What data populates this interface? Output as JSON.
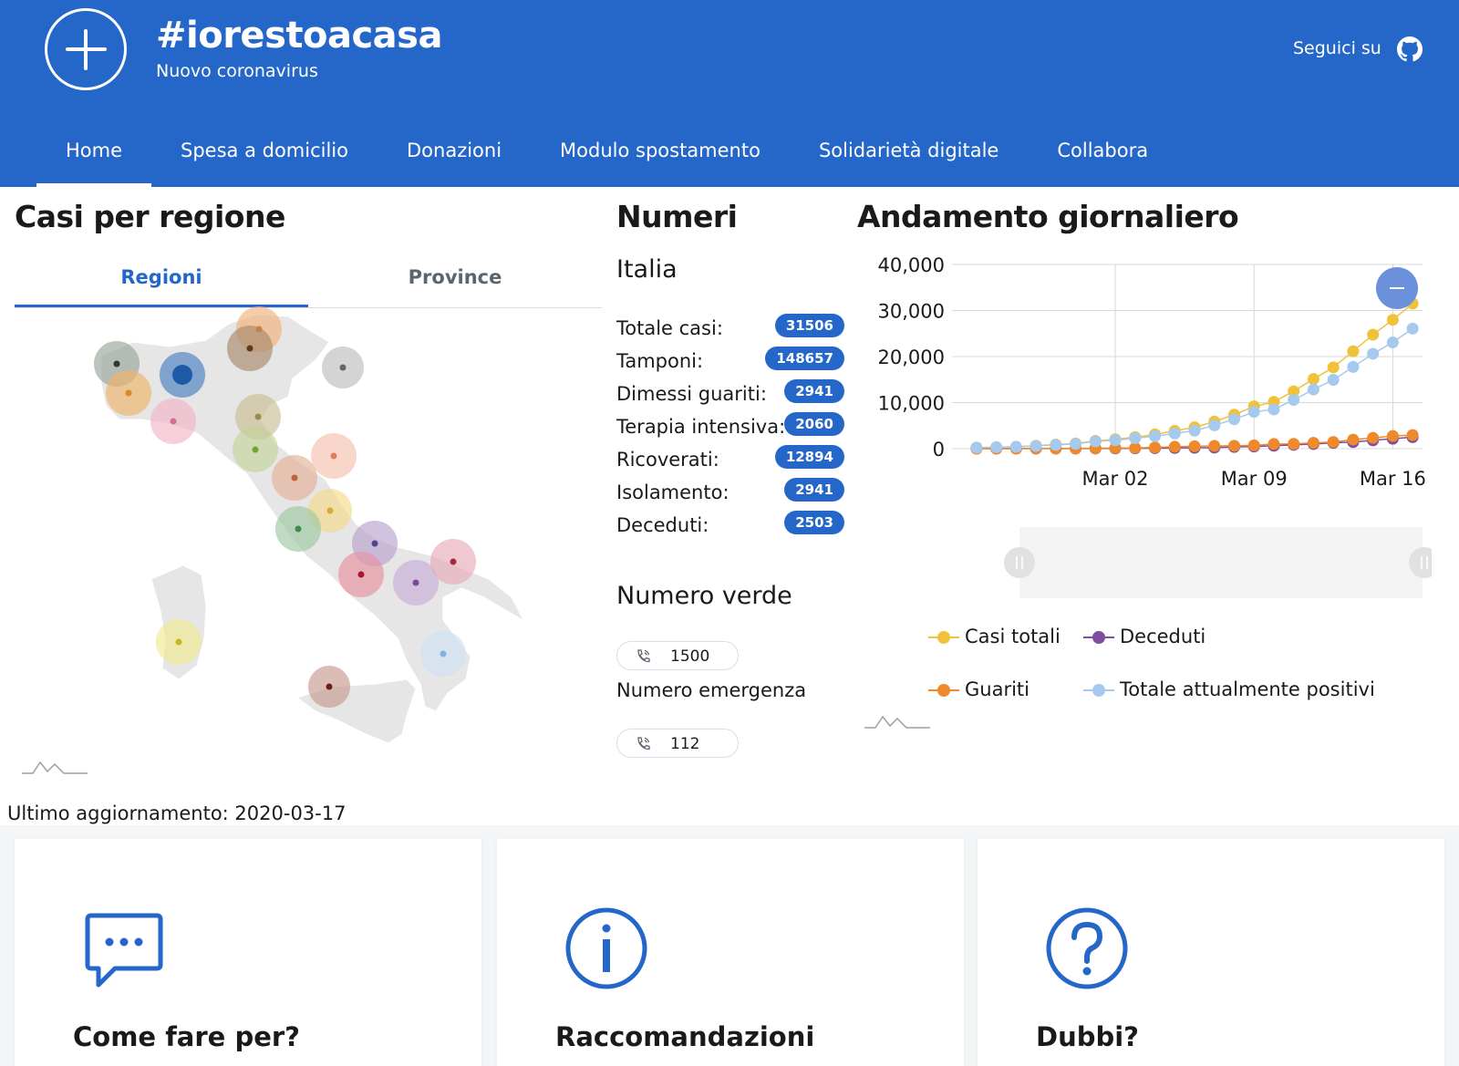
{
  "header": {
    "title": "#iorestoacasa",
    "subtitle": "Nuovo coronavirus",
    "follow_label": "Seguici su",
    "logo_icon": "plus-circle-icon",
    "social_icon": "github-icon",
    "background_color": "#2567c8"
  },
  "nav": {
    "items": [
      {
        "label": "Home",
        "active": true
      },
      {
        "label": "Spesa a domicilio"
      },
      {
        "label": "Donazioni"
      },
      {
        "label": "Modulo spostamento"
      },
      {
        "label": "Solidarietà digitale"
      },
      {
        "label": "Collabora"
      }
    ]
  },
  "map_section": {
    "title": "Casi per regione",
    "tabs": [
      {
        "label": "Regioni",
        "active": true
      },
      {
        "label": "Province"
      }
    ],
    "last_update": "Ultimo aggiornamento: 2020-03-17"
  },
  "numbers_section": {
    "title": "Numeri",
    "area": "Italia",
    "stats": [
      {
        "label": "Totale casi:",
        "value": "31506"
      },
      {
        "label": "Tamponi:",
        "value": "148657"
      },
      {
        "label": "Dimessi guariti:",
        "value": "2941"
      },
      {
        "label": "Terapia intensiva:",
        "value": "2060"
      },
      {
        "label": "Ricoverati:",
        "value": "12894"
      },
      {
        "label": "Isolamento:",
        "value": "2941"
      },
      {
        "label": "Deceduti:",
        "value": "2503"
      }
    ],
    "numero_verde_title": "Numero verde",
    "numero_verde": "1500",
    "emergenza_label": "Numero emergenza",
    "numero_emergenza": "112"
  },
  "chart_section": {
    "title": "Andamento giornaliero",
    "zoom_button_icon": "minus-icon"
  },
  "chart_data": {
    "type": "line",
    "title": "Andamento giornaliero",
    "ylim": [
      0,
      40000
    ],
    "yticks": [
      "0",
      "10,000",
      "20,000",
      "30,000",
      "40,000"
    ],
    "xticks": [
      "Mar 02",
      "Mar 09",
      "Mar 16"
    ],
    "x": [
      "Feb 24",
      "Feb 25",
      "Feb 26",
      "Feb 27",
      "Feb 28",
      "Feb 29",
      "Mar 01",
      "Mar 02",
      "Mar 03",
      "Mar 04",
      "Mar 05",
      "Mar 06",
      "Mar 07",
      "Mar 08",
      "Mar 09",
      "Mar 10",
      "Mar 11",
      "Mar 12",
      "Mar 13",
      "Mar 14",
      "Mar 15",
      "Mar 16",
      "Mar 17"
    ],
    "grid": true,
    "legend_position": "bottom",
    "series": [
      {
        "name": "Casi totali",
        "color": "#f0c23a",
        "values": [
          229,
          322,
          400,
          650,
          888,
          1128,
          1694,
          2036,
          2502,
          3089,
          3858,
          4636,
          5883,
          7375,
          9172,
          10149,
          12462,
          15113,
          17660,
          21157,
          24747,
          27980,
          31506
        ]
      },
      {
        "name": "Deceduti",
        "color": "#7e4e9c",
        "values": [
          7,
          10,
          12,
          17,
          21,
          29,
          34,
          52,
          79,
          107,
          148,
          197,
          233,
          366,
          463,
          631,
          827,
          1016,
          1266,
          1441,
          1809,
          2158,
          2503
        ]
      },
      {
        "name": "Guariti",
        "color": "#ee8a2c",
        "values": [
          1,
          1,
          3,
          45,
          46,
          50,
          83,
          149,
          160,
          276,
          414,
          523,
          589,
          622,
          724,
          1004,
          1045,
          1258,
          1439,
          1966,
          2335,
          2749,
          2941
        ]
      },
      {
        "name": "Totale attualmente positivi",
        "color": "#a6c9ee",
        "values": [
          221,
          311,
          385,
          588,
          821,
          1049,
          1577,
          1835,
          2263,
          2706,
          3296,
          3916,
          5061,
          6387,
          7985,
          8514,
          10590,
          12839,
          14955,
          17750,
          20603,
          23073,
          26062
        ]
      }
    ]
  },
  "cards": [
    {
      "title": "Come fare per?",
      "icon": "chat-bubble-icon"
    },
    {
      "title": "Raccomandazioni",
      "icon": "info-circle-icon"
    },
    {
      "title": "Dubbi?",
      "icon": "question-circle-icon"
    }
  ]
}
